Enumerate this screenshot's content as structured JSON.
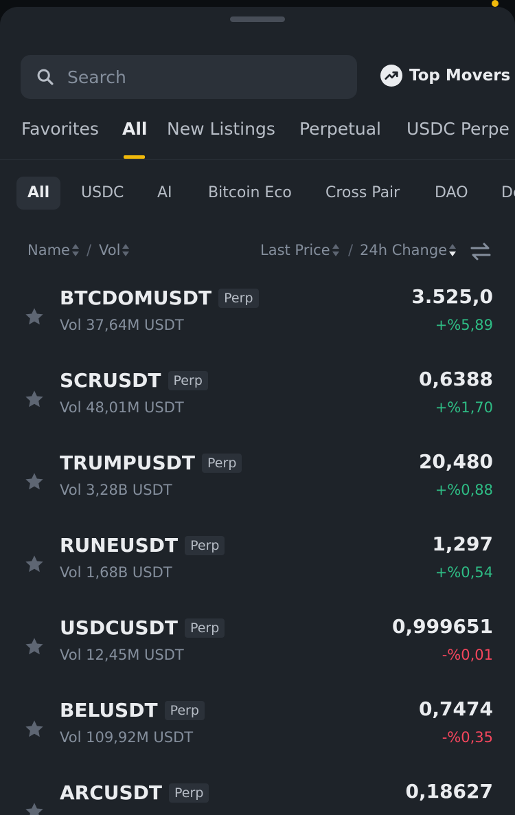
{
  "search": {
    "placeholder": "Search"
  },
  "top_movers": {
    "label": "Top Movers",
    "icon": "trending-up-icon"
  },
  "tabs": [
    {
      "label": "Favorites"
    },
    {
      "label": "All",
      "active": true
    },
    {
      "label": "New Listings"
    },
    {
      "label": "Perpetual"
    },
    {
      "label": "USDC Perpe"
    }
  ],
  "chips": [
    {
      "label": "All",
      "active": true
    },
    {
      "label": "USDC"
    },
    {
      "label": "AI"
    },
    {
      "label": "Bitcoin Eco"
    },
    {
      "label": "Cross Pair"
    },
    {
      "label": "DAO"
    },
    {
      "label": "De"
    }
  ],
  "columns": {
    "name": "Name",
    "sep1": "/",
    "vol": "Vol",
    "last_price": "Last Price",
    "sep2": "/",
    "change": "24h Change"
  },
  "rows": [
    {
      "symbol": "BTCDOMUSDT",
      "badge": "Perp",
      "volume": "Vol 37,64M USDT",
      "price": "3.525,0",
      "change": "+%5,89",
      "direction": "up"
    },
    {
      "symbol": "SCRUSDT",
      "badge": "Perp",
      "volume": "Vol 48,01M USDT",
      "price": "0,6388",
      "change": "+%1,70",
      "direction": "up"
    },
    {
      "symbol": "TRUMPUSDT",
      "badge": "Perp",
      "volume": "Vol 3,28B USDT",
      "price": "20,480",
      "change": "+%0,88",
      "direction": "up"
    },
    {
      "symbol": "RUNEUSDT",
      "badge": "Perp",
      "volume": "Vol 1,68B USDT",
      "price": "1,297",
      "change": "+%0,54",
      "direction": "up"
    },
    {
      "symbol": "USDCUSDT",
      "badge": "Perp",
      "volume": "Vol 12,45M USDT",
      "price": "0,999651",
      "change": "-%0,01",
      "direction": "down"
    },
    {
      "symbol": "BELUSDT",
      "badge": "Perp",
      "volume": "Vol 109,92M USDT",
      "price": "0,7474",
      "change": "-%0,35",
      "direction": "down"
    },
    {
      "symbol": "ARCUSDT",
      "badge": "Perp",
      "volume": "",
      "price": "0,18627",
      "change": "",
      "direction": "up"
    }
  ],
  "colors": {
    "background": "#1e2329",
    "up": "#2ebd85",
    "down": "#f6465d",
    "accent": "#f0b90b"
  }
}
